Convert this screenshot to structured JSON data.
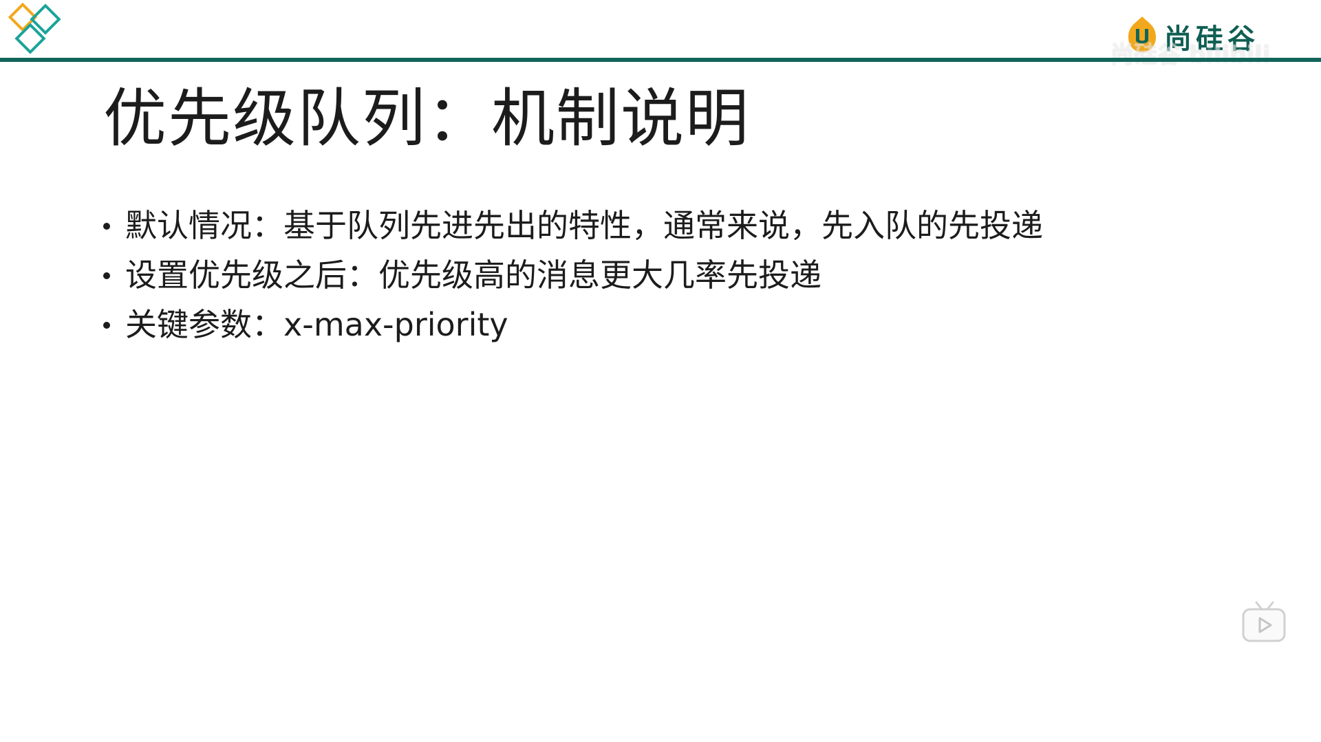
{
  "slide": {
    "title": "优先级队列：机制说明",
    "bullets": [
      "默认情况：基于队列先进先出的特性，通常来说，先入队的先投递",
      "设置优先级之后：优先级高的消息更大几率先投递",
      "关键参数：x-max-priority"
    ]
  },
  "brand": {
    "name": "尚硅谷",
    "icon": "u-flame-logo-icon"
  },
  "watermark": {
    "text": "尚硅谷 bilibili"
  },
  "decor": {
    "corner_logo_icon": "diamond-logo-icon",
    "play_icon": "tv-play-icon"
  },
  "colors": {
    "accent_green": "#11655a",
    "logo_orange": "#f2a81d",
    "logo_teal": "#1aa39a",
    "text": "#1c1c1c"
  }
}
